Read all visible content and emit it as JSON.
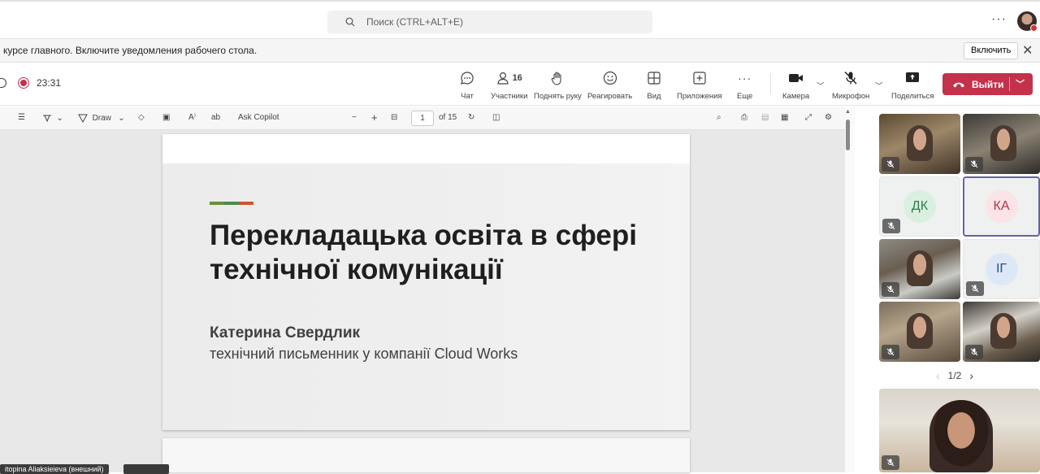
{
  "search": {
    "placeholder": "Поиск (CTRL+ALT+E)",
    "more": "···"
  },
  "notification": {
    "text": "курсе главного. Включите уведомления рабочего стола.",
    "enable_label": "Включить",
    "close_glyph": "✕"
  },
  "meeting": {
    "timer": "23:31",
    "participants_count": "16",
    "buttons": {
      "chat": "Чат",
      "participants": "Участники",
      "raise_hand": "Поднять руку",
      "react": "Реагировать",
      "view": "Вид",
      "apps": "Приложения",
      "more": "Еще",
      "camera": "Камера",
      "mic": "Микрофон",
      "share": "Поделиться"
    },
    "leave_label": "Выйти",
    "colors": {
      "leave": "#c4314b",
      "accent": "#6264a7"
    }
  },
  "pdf_toolbar": {
    "draw_label": "Draw",
    "copilot_label": "Ask Copilot",
    "current_page": "1",
    "page_total": "of 15"
  },
  "slide": {
    "title": "Перекладацька освіта в сфері технічної комунікації",
    "author": "Катерина Свердлик",
    "role": "технічний письменник у компанії Cloud Works",
    "accent_colors": [
      "#6c8f3a",
      "#4a8a4e",
      "#d1562a"
    ]
  },
  "presenter_nameplate": "itopina Aliaksieieva (внешний)",
  "gallery": {
    "tiles": [
      {
        "type": "video",
        "muted": true
      },
      {
        "type": "video",
        "muted": true
      },
      {
        "type": "avatar",
        "initials": "ДК",
        "color": "#2e7d4f",
        "bg": "#d9f0e0",
        "muted": true
      },
      {
        "type": "avatar",
        "initials": "КА",
        "color": "#b0344a",
        "bg": "#fbe3e6",
        "muted": false,
        "active": true
      },
      {
        "type": "video",
        "muted": true
      },
      {
        "type": "avatar",
        "initials": "ІГ",
        "color": "#2b4f8a",
        "bg": "#dde8f7",
        "muted": true
      },
      {
        "type": "video",
        "muted": true
      },
      {
        "type": "video",
        "muted": true
      }
    ],
    "pager": "1/2"
  }
}
